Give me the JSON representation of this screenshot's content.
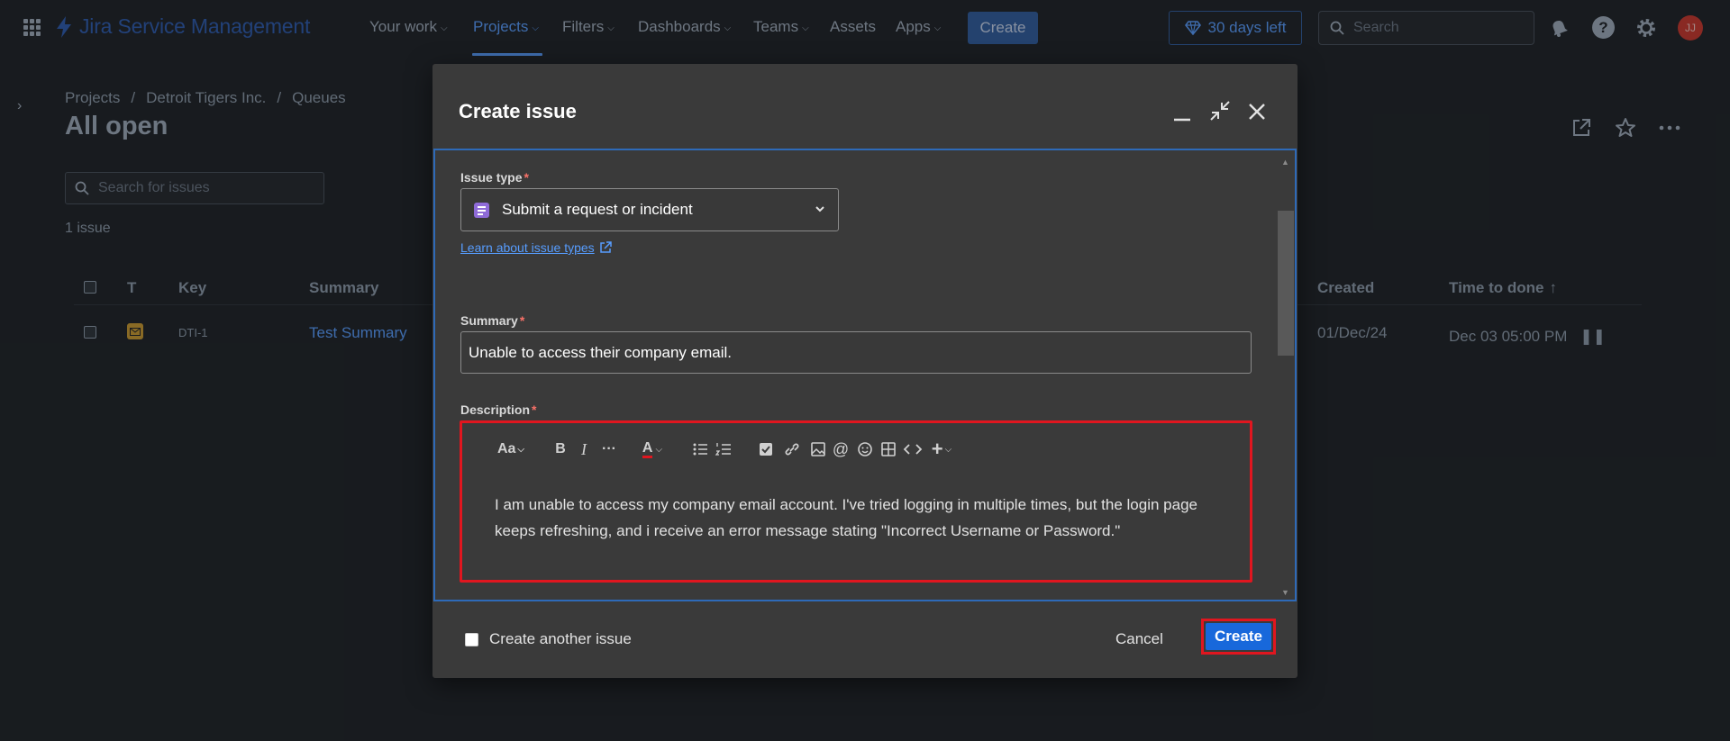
{
  "topnav": {
    "product_name": "Jira Service Management",
    "items": [
      {
        "label": "Your work",
        "has_menu": true
      },
      {
        "label": "Projects",
        "has_menu": true,
        "active": true
      },
      {
        "label": "Filters",
        "has_menu": true
      },
      {
        "label": "Dashboards",
        "has_menu": true
      },
      {
        "label": "Teams",
        "has_menu": true
      },
      {
        "label": "Assets",
        "has_menu": false
      },
      {
        "label": "Apps",
        "has_menu": true
      }
    ],
    "create_label": "Create",
    "trial_label": "30 days left",
    "search_placeholder": "Search",
    "avatar_initials": "JJ",
    "icons": [
      "app-switcher-icon",
      "search-icon",
      "notifications-icon",
      "help-icon",
      "settings-icon"
    ]
  },
  "page": {
    "breadcrumb": [
      "Projects",
      "Detroit Tigers Inc.",
      "Queues"
    ],
    "title": "All open",
    "search_placeholder": "Search for issues",
    "issue_count": "1 issue",
    "columns": {
      "type": "T",
      "key": "Key",
      "summary": "Summary",
      "created": "Created",
      "time_to_done": "Time to done"
    },
    "rows": [
      {
        "key": "DTI-1",
        "summary": "Test Summary",
        "created": "01/Dec/24",
        "time_to_done": "Dec 03 05:00 PM"
      }
    ]
  },
  "modal": {
    "title": "Create issue",
    "issue_type_label": "Issue type",
    "issue_type_value": "Submit a request or incident",
    "learn_link": "Learn about issue types",
    "summary_label": "Summary",
    "summary_value": "Unable to access their company email.",
    "description_label": "Description",
    "description_text": "I am unable to access my company email account. I've tried logging in multiple times, but the login page keeps refreshing, and i  receive an error message stating \"Incorrect Username or Password.\"",
    "toolbar": {
      "text_style": "Aa"
    },
    "create_another_label": "Create another issue",
    "cancel_label": "Cancel",
    "create_label": "Create"
  },
  "colors": {
    "background": "#1d2125",
    "modal": "#3a3a3a",
    "accent": "#579dff",
    "primary_button": "#1868db",
    "highlight": "#e0161f",
    "issue_type_icon": "#8f6bd8"
  }
}
